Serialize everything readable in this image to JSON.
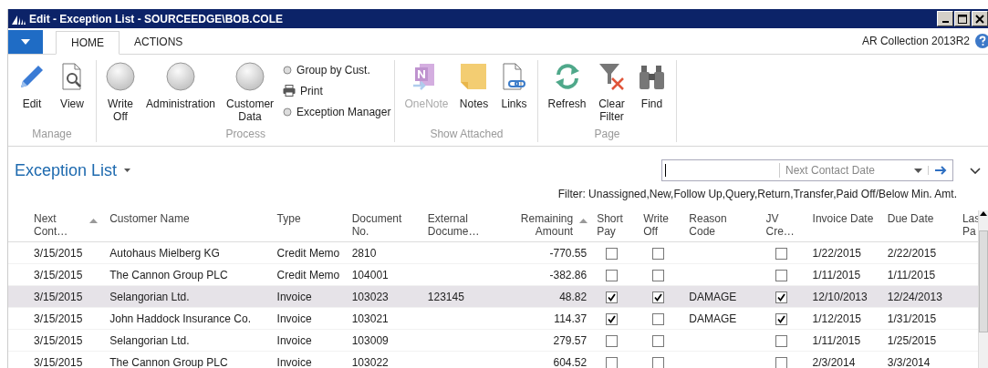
{
  "window": {
    "title": "Edit - Exception List - SOURCEEDGE\\BOB.COLE"
  },
  "tabs": [
    {
      "label": "HOME",
      "selected": true
    },
    {
      "label": "ACTIONS",
      "selected": false
    }
  ],
  "company": "AR Collection 2013R2",
  "ribbon": [
    {
      "label": "Manage",
      "items": [
        {
          "label": "Edit",
          "kind": "large",
          "disabled": false
        },
        {
          "label": "View",
          "kind": "large",
          "disabled": false
        }
      ]
    },
    {
      "label": "Process",
      "items": [
        {
          "label": "Write Off",
          "kind": "large",
          "disabled": false
        },
        {
          "label": "Administration",
          "kind": "large",
          "disabled": false
        },
        {
          "label": "Customer Data",
          "kind": "large",
          "disabled": false
        },
        {
          "label": "Group by Cust.",
          "kind": "small",
          "disabled": false
        },
        {
          "label": "Print",
          "kind": "small",
          "disabled": false
        },
        {
          "label": "Exception Manager",
          "kind": "small",
          "disabled": false
        }
      ]
    },
    {
      "label": "Show Attached",
      "items": [
        {
          "label": "OneNote",
          "kind": "large",
          "disabled": true
        },
        {
          "label": "Notes",
          "kind": "large",
          "disabled": false
        },
        {
          "label": "Links",
          "kind": "large",
          "disabled": false
        }
      ]
    },
    {
      "label": "Page",
      "items": [
        {
          "label": "Refresh",
          "kind": "large",
          "disabled": false
        },
        {
          "label": "Clear Filter",
          "kind": "large",
          "disabled": false
        },
        {
          "label": "Find",
          "kind": "large",
          "disabled": false
        }
      ]
    }
  ],
  "page": {
    "title": "Exception List",
    "search_field": "Next Contact Date",
    "filter": "Filter: Unassigned,New,Follow Up,Query,Return,Transfer,Paid Off/Below Min. Amt."
  },
  "table": {
    "columns": [
      {
        "label": "Next\nCont…",
        "kind": "text",
        "sorted": true
      },
      {
        "label": "Customer Name",
        "kind": "text",
        "sorted": false
      },
      {
        "label": "Type",
        "kind": "text",
        "sorted": false
      },
      {
        "label": "Document\nNo.",
        "kind": "text",
        "sorted": false
      },
      {
        "label": "External\nDocume…",
        "kind": "text",
        "sorted": false
      },
      {
        "label": "Remaining\nAmount",
        "kind": "number",
        "sorted": true
      },
      {
        "label": "Short\nPay",
        "kind": "check",
        "sorted": false
      },
      {
        "label": "Write\nOff",
        "kind": "check",
        "sorted": false
      },
      {
        "label": "Reason\nCode",
        "kind": "text",
        "sorted": false
      },
      {
        "label": "JV\nCre…",
        "kind": "check",
        "sorted": false
      },
      {
        "label": "Invoice Date",
        "kind": "text",
        "sorted": false
      },
      {
        "label": "Due Date",
        "kind": "text",
        "sorted": false
      },
      {
        "label": "Las\nPa",
        "kind": "text",
        "sorted": false
      }
    ],
    "rows": [
      {
        "selected": false,
        "cells": [
          "3/15/2015",
          "Autohaus Mielberg KG",
          "Credit Memo",
          "2810",
          "",
          "-770.55",
          false,
          false,
          "",
          false,
          "1/22/2015",
          "2/22/2015",
          ""
        ]
      },
      {
        "selected": false,
        "cells": [
          "3/15/2015",
          "The Cannon Group PLC",
          "Credit Memo",
          "104001",
          "",
          "-382.86",
          false,
          false,
          "",
          false,
          "1/11/2015",
          "1/11/2015",
          ""
        ]
      },
      {
        "selected": true,
        "cells": [
          "3/15/2015",
          "Selangorian Ltd.",
          "Invoice",
          "103023",
          "123145",
          "48.82",
          true,
          true,
          "DAMAGE",
          true,
          "12/10/2013",
          "12/24/2013",
          ""
        ]
      },
      {
        "selected": false,
        "cells": [
          "3/15/2015",
          "John Haddock Insurance Co.",
          "Invoice",
          "103021",
          "",
          "114.37",
          true,
          false,
          "DAMAGE",
          true,
          "1/12/2015",
          "1/31/2015",
          ""
        ]
      },
      {
        "selected": false,
        "cells": [
          "3/15/2015",
          "Selangorian Ltd.",
          "Invoice",
          "103009",
          "",
          "279.57",
          false,
          false,
          "",
          false,
          "1/11/2015",
          "1/25/2015",
          ""
        ]
      },
      {
        "selected": false,
        "cells": [
          "3/15/2015",
          "The Cannon Group PLC",
          "Invoice",
          "103022",
          "",
          "604.52",
          false,
          false,
          "",
          false,
          "2/3/2014",
          "3/3/2014",
          ""
        ]
      }
    ]
  }
}
